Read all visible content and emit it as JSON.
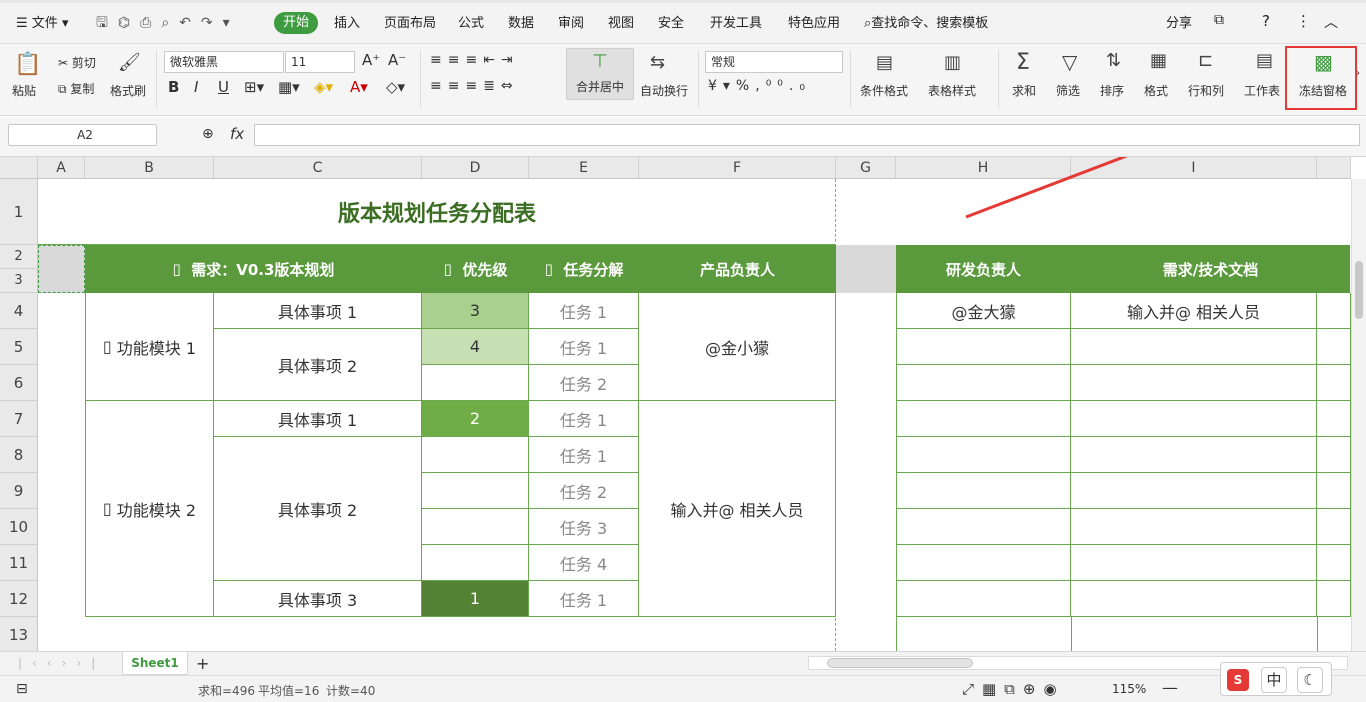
{
  "menubar": {
    "file": "文件",
    "tabs": [
      "开始",
      "插入",
      "页面布局",
      "公式",
      "数据",
      "审阅",
      "视图",
      "安全",
      "开发工具",
      "特色应用"
    ],
    "search": "查找命令、搜索模板",
    "share": "分享"
  },
  "ribbon": {
    "paste": "粘贴",
    "cut": "剪切",
    "copy": "复制",
    "format_painter": "格式刷",
    "font_name": "微软雅黑",
    "font_size": "11",
    "merge_center": "合并居中",
    "wrap_text": "自动换行",
    "number_format": "常规",
    "cond_format": "条件格式",
    "table_style": "表格样式",
    "sum": "求和",
    "filter": "筛选",
    "sort": "排序",
    "format": "格式",
    "row_col": "行和列",
    "worksheet": "工作表",
    "freeze": "冻结窗格"
  },
  "formula": {
    "name_box": "A2",
    "fx": "fx"
  },
  "columns": [
    "A",
    "B",
    "C",
    "D",
    "E",
    "F",
    "G",
    "H",
    "I"
  ],
  "rows": [
    "1",
    "2",
    "3",
    "4",
    "5",
    "6",
    "7",
    "8",
    "9",
    "10",
    "11",
    "12",
    "13"
  ],
  "sheet": {
    "title": "版本规划任务分配表",
    "headers": {
      "req": "需求：V0.3版本规划",
      "priority": "优先级",
      "task": "任务分解",
      "pm": "产品负责人",
      "dev": "研发负责人",
      "doc": "需求/技术文档"
    },
    "module1": "功能模块 1",
    "module2": "功能模块 2",
    "items": [
      "具体事项 1",
      "具体事项 2",
      "具体事项 1",
      "具体事项 2",
      "具体事项 3"
    ],
    "priorities": [
      "3",
      "4",
      "2",
      "1"
    ],
    "tasks": [
      "任务 1",
      "任务 1",
      "任务 2",
      "任务 1",
      "任务 1",
      "任务 2",
      "任务 3",
      "任务 4",
      "任务 1"
    ],
    "pm1": "@金小獴",
    "pm2": "输入并@ 相关人员",
    "dev1": "@金大獴",
    "doc1": "输入并@ 相关人员"
  },
  "tabs": {
    "sheet1": "Sheet1",
    "add": "+"
  },
  "status": {
    "sum": "求和=496",
    "avg": "平均值=16",
    "count": "计数=40",
    "zoom": "115%"
  },
  "watermark": {
    "ime_cn": "中"
  },
  "colors": {
    "green_header": "#5a9a3d",
    "accent_red": "#e53935"
  }
}
